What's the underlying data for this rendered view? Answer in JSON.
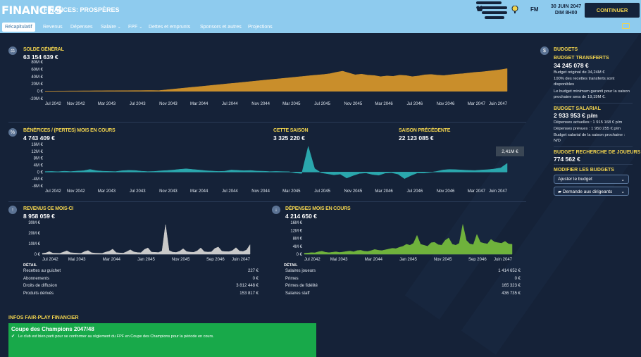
{
  "header": {
    "title": "FINANCES",
    "subtitle": "FINANCES: PROSPÈRES",
    "date_line1": "30 JUIN 2047",
    "date_line2": "DIM 8H00",
    "fm_label": "FM",
    "continue_label": "CONTINUER"
  },
  "tabs": [
    {
      "label": "Récapitulatif"
    },
    {
      "label": "Revenus"
    },
    {
      "label": "Dépenses"
    },
    {
      "label": "Salaire"
    },
    {
      "label": "FPF"
    },
    {
      "label": "Dettes et emprunts"
    },
    {
      "label": "Sponsors et autres"
    },
    {
      "label": "Projections"
    }
  ],
  "tab_carets": {
    "salaire": "⌄",
    "fpf": "⌄"
  },
  "balance": {
    "title": "SOLDE GÉNÉRAL",
    "value": "63 154 639 €",
    "y_ticks": [
      "80M €",
      "60M €",
      "40M €",
      "20M €",
      "0 €",
      "-20M €"
    ],
    "x_ticks": [
      "Jul 2042",
      "Nov 2042",
      "Mar 2043",
      "Jul 2043",
      "Nov 2043",
      "Mar 2044",
      "Jul 2044",
      "Nov 2044",
      "Mar 2045",
      "Jul 2045",
      "Nov 2045",
      "Mar 2046",
      "Jul 2046",
      "Nov 2046",
      "Mar 2047",
      "Juin 2047"
    ]
  },
  "profit": {
    "title": "BÉNÉFICES / (PERTES) MOIS EN COURS",
    "value": "4 743 409 €",
    "season_title": "CETTE SAISON",
    "season_value": "3 325 220 €",
    "prev_title": "SAISON PRÉCÉDENTE",
    "prev_value": "22 123 085 €",
    "tooltip": "2,41M €",
    "y_ticks": [
      "16M €",
      "12M €",
      "8M €",
      "4M €",
      "0 €",
      "-4M €",
      "-8M €"
    ],
    "x_ticks": [
      "Jul 2042",
      "Nov 2042",
      "Mar 2043",
      "Jul 2043",
      "Nov 2043",
      "Mar 2044",
      "Jul 2044",
      "Nov 2044",
      "Mar 2045",
      "Jul 2045",
      "Nov 2045",
      "Mar 2046",
      "Jul 2046",
      "Nov 2046",
      "Mar 2047",
      "Juin 2047"
    ]
  },
  "revenue": {
    "title": "REVENUS CE MOIS-CI",
    "value": "8 958 059 €",
    "y_ticks": [
      "30M €",
      "20M €",
      "10M €",
      "0 €"
    ],
    "x_ticks": [
      "Jul 2042",
      "Mai 2043",
      "Mar 2044",
      "Jan 2045",
      "Nov 2045",
      "Sep 2046",
      "Juin 2047"
    ],
    "detail_label": "DÉTAIL",
    "rows": [
      {
        "label": "Recettes au guichet",
        "value": "227 €"
      },
      {
        "label": "Abonnements",
        "value": "0 €"
      },
      {
        "label": "Droits de diffusion",
        "value": "3 812 448 €"
      },
      {
        "label": "Produits dérivés",
        "value": "153 817 €"
      }
    ]
  },
  "expenses": {
    "title": "DÉPENSES MOIS EN COURS",
    "value": "4 214 650 €",
    "y_ticks": [
      "16M €",
      "12M €",
      "8M €",
      "4M €",
      "0 €"
    ],
    "x_ticks": [
      "Jul 2042",
      "Mai 2043",
      "Mar 2044",
      "Jan 2045",
      "Nov 2045",
      "Sep 2046",
      "Juin 2047"
    ],
    "detail_label": "DÉTAIL",
    "rows": [
      {
        "label": "Salaires joueurs",
        "value": "1 414 652 €"
      },
      {
        "label": "Primes",
        "value": "0 €"
      },
      {
        "label": "Primes de fidélité",
        "value": "165 323 €"
      },
      {
        "label": "Salaires staff",
        "value": "436 735 €"
      }
    ]
  },
  "budgets": {
    "title": "BUDGETS",
    "transfer_title": "BUDGET TRANSFERTS",
    "transfer_value": "34 245 078 €",
    "transfer_note1": "Budget original de 34,24M €",
    "transfer_note2": "100% des recettes transferts sont disponibles",
    "transfer_note3": "Le budget minimum garanti pour la saison prochaine sera de 19,19M €.",
    "salary_title": "BUDGET SALARIAL",
    "salary_value": "2 933 953 € p/m",
    "salary_note1": "Dépenses actuelles : 1 915 168 € p/m",
    "salary_note2": "Dépenses prévues : 1 950 255 € p/m",
    "salary_note3": "Budget salarial de la saison prochaine : N/D",
    "scout_title": "BUDGET RECHERCHE DE JOUEURS",
    "scout_value": "774 562 €",
    "modify_title": "MODIFIER LES BUDGETS",
    "adjust_label": "Ajuster le budget",
    "request_label": "Demande aux dirigeants"
  },
  "ffp": {
    "title": "INFOS FAIR-PLAY FINANCIER",
    "competition": "Coupe des Champions 2047/48",
    "message": "Le club est bien parti pour se conformer au règlement du FPF en Coupe des Champions pour la période en cours."
  },
  "colors": {
    "balance": "#c98e2b",
    "profit": "#2aa7ad",
    "revenue": "#c9c9c9",
    "expenses": "#6fb23c",
    "accent": "#f2d44e"
  }
}
